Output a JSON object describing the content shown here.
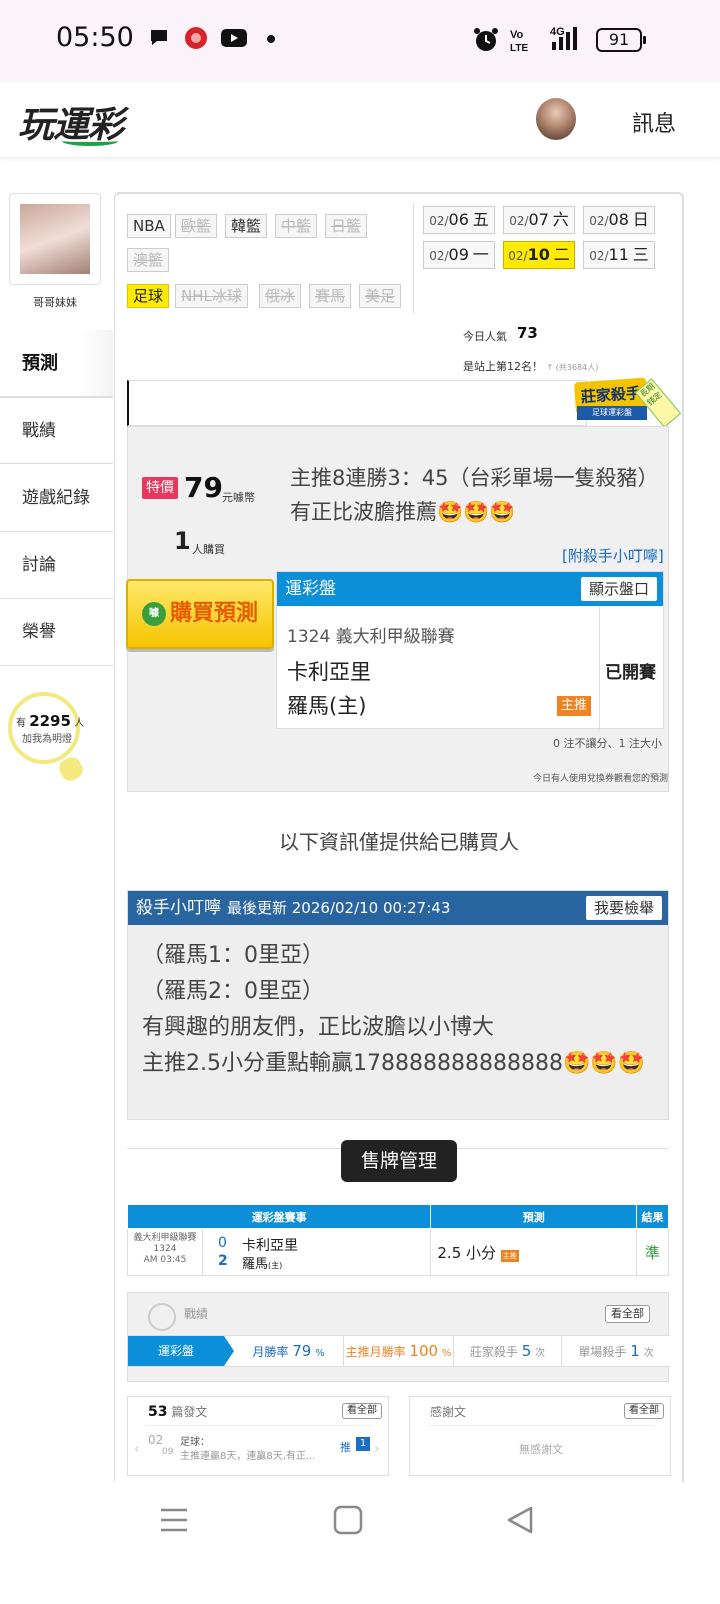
{
  "status_bar": {
    "time": "05:50",
    "battery": "91",
    "signal": "4G"
  },
  "header": {
    "logo": "玩運彩",
    "messages": "訊息"
  },
  "sidebar": {
    "user_name": "哥哥妹妹",
    "items": [
      {
        "label": "預測",
        "active": true
      },
      {
        "label": "戰績"
      },
      {
        "label": "遊戲紀錄"
      },
      {
        "label": "討論"
      },
      {
        "label": "榮譽"
      }
    ],
    "fans_prefix": "有",
    "fans_count": "2295",
    "fans_suffix": "人",
    "fans_add": "加我為明燈"
  },
  "sports": [
    "NBA",
    "歐籃",
    "韓籃",
    "中籃",
    "日籃",
    "澳籃",
    "足球",
    "NHL冰球",
    "俄冰",
    "賽馬",
    "美足"
  ],
  "dates": [
    {
      "md": "02/",
      "d": "06",
      "w": "五"
    },
    {
      "md": "02/",
      "d": "07",
      "w": "六"
    },
    {
      "md": "02/",
      "d": "08",
      "w": "日"
    },
    {
      "md": "02/",
      "d": "09",
      "w": "一"
    },
    {
      "md": "02/",
      "d": "10",
      "w": "二",
      "selected": true
    },
    {
      "md": "02/",
      "d": "11",
      "w": "三"
    }
  ],
  "popularity": {
    "label": "今日人氣",
    "value": "73",
    "rank_text": "是站上第12名！",
    "rank_small": "↑ (共3684人)"
  },
  "badge": {
    "title": "莊家殺手",
    "sub": "足球運彩盤",
    "ribbon": "長期錢定"
  },
  "prediction": {
    "special_tag": "特價",
    "price": "79",
    "price_unit": "元噱幣",
    "buyers": "1",
    "buyers_unit": "人購買",
    "title": "主推8連勝3：45（台彩單場一隻殺豬）有正比波膽推薦🤩🤩🤩",
    "attach": "[附殺手小叮嚀]",
    "buy_button": "購買預測",
    "buy_disc": "噱"
  },
  "game": {
    "header": "運彩盤",
    "show_button": "顯示盤口",
    "league": "1324 義大利甲級聯賽",
    "team1": "卡利亞里",
    "team2": "羅馬(主)",
    "pick_tag": "主推",
    "status": "已開賽",
    "note": "0 注不讓分、1 注大小",
    "note2": "今日有人使用兌換券觀看您的預測"
  },
  "buyer_only_text": "以下資訊僅提供給已購買人",
  "tips": {
    "title": "殺手小叮嚀",
    "updated": "最後更新 2026/02/10 00:27:43",
    "report_button": "我要檢舉",
    "lines": [
      "（羅馬1：0里亞）",
      "（羅馬2：0里亞）",
      "有興趣的朋友們，正比波膽以小博大",
      "主推2.5小分重點輸贏178888888888888🤩🤩🤩"
    ]
  },
  "sales_button": "售牌管理",
  "result_table": {
    "headers": [
      "運彩盤賽事",
      "預測",
      "結果"
    ],
    "row": {
      "league": "義大利甲級聯賽",
      "code": "1324",
      "time": "AM 03:45",
      "score1": "0",
      "score2": "2",
      "team1": "卡利亞里",
      "team2": "羅馬",
      "team2_tag": "(主)",
      "pick": "2.5 小分",
      "pick_tag": "主推",
      "result": "準"
    }
  },
  "record": {
    "label": "戰績",
    "all_button": "看全部",
    "segments": [
      {
        "label": "運彩盤"
      },
      {
        "label": "月勝率",
        "value": "79",
        "unit": "%"
      },
      {
        "label": "主推月勝率",
        "value": "100",
        "unit": "%"
      },
      {
        "label": "莊家殺手",
        "value": "5",
        "unit": "次"
      },
      {
        "label": "單場殺手",
        "value": "1",
        "unit": "次"
      }
    ]
  },
  "posts": {
    "count": "53",
    "label": "篇發文",
    "all_button": "看全部",
    "date_top": "02",
    "date_bottom": "09",
    "item_cat": "足球：",
    "item_text": "主推連贏8天，連贏8天,有正...",
    "item_tag": "推",
    "item_num": "1"
  },
  "thanks": {
    "label": "感謝文",
    "all_button": "看全部",
    "empty": "無感謝文"
  },
  "colors": {
    "accent_blue": "#0b8fd8",
    "tips_blue": "#2864a0",
    "highlight_yellow": "#ffea00",
    "special_red": "#e8385d",
    "pick_orange": "#f0821f",
    "correct_green": "#2a9d3a"
  }
}
